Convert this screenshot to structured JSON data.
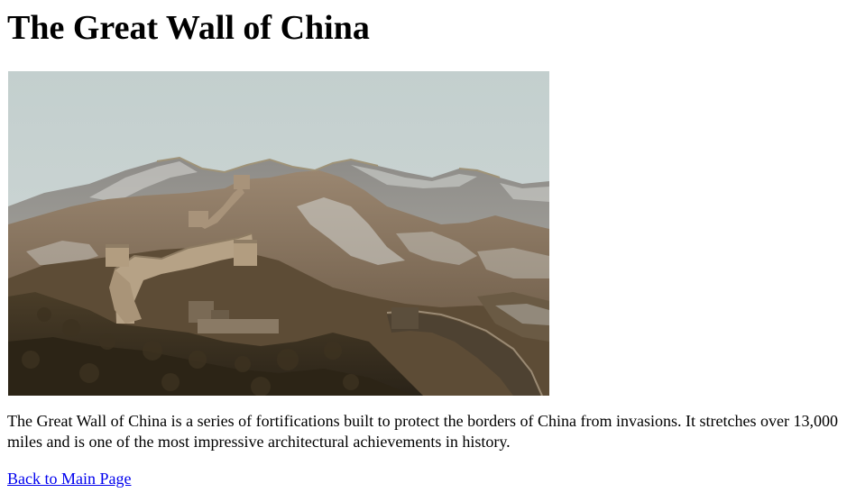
{
  "page": {
    "title": "The Great Wall of China",
    "description": "The Great Wall of China is a series of fortifications built to protect the borders of China from invasions. It stretches over 13,000 miles and is one of the most impressive architectural achievements in history.",
    "back_link": "Back to Main Page"
  },
  "image": {
    "subject": "great-wall-landscape-photo",
    "colors": {
      "sky": "#c9d3d2",
      "mountains": "#8b8880",
      "hills": "#a58e74",
      "forest": "#3a3120",
      "wall": "#b49f82"
    }
  },
  "colors": {
    "link": "#0000ee",
    "text": "#000000",
    "background": "#ffffff"
  }
}
